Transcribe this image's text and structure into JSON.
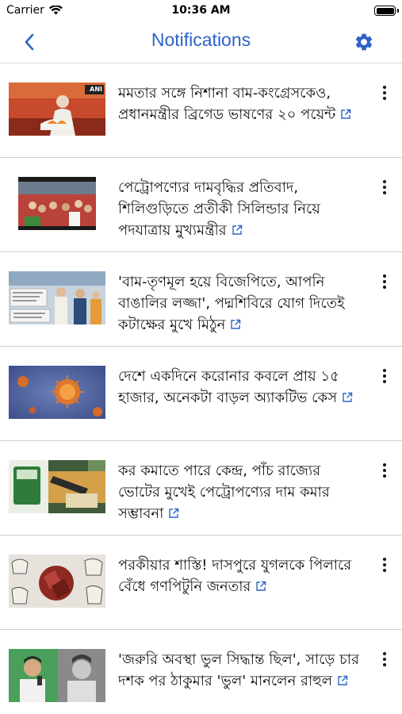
{
  "status_bar": {
    "carrier": "Carrier",
    "time": "10:36 AM"
  },
  "nav": {
    "title": "Notifications",
    "back_icon": "chevron-left-icon",
    "settings_icon": "gear-icon",
    "accent": "#2d63c9"
  },
  "notifications": [
    {
      "headline": "মমতার সঙ্গে নিশানা বাম-কংগ্রেসকেও, প্রধানমন্ত্রীর ব্রিগেড ভাষণের ২০ পয়েন্ট",
      "thumb_badge": "ANI"
    },
    {
      "headline": "পেট্রোপণ্যের দামবৃদ্ধির প্রতিবাদ, শিলিগুড়িতে প্রতীকী সিলিন্ডার নিয়ে পদযাত্রায় মুখ্যমন্ত্রীর"
    },
    {
      "headline": "'বাম-তৃণমূল হয়ে বিজেপিতে, আপনি বাঙালির লজ্জা', পদ্মশিবিরে যোগ দিতেই কটাক্ষের মুখে মিঠুন"
    },
    {
      "headline": "দেশে একদিনে করোনার কবলে প্রায় ১৫ হাজার, অনেকটা বাড়ল অ্যাকটিভ কেস"
    },
    {
      "headline": "কর কমাতে পারে কেন্দ্র, পাঁচ রাজ্যের ভোটের মুখেই পেট্রোপণ্যের দাম কমার সম্ভাবনা"
    },
    {
      "headline": "পরকীয়ার শাস্তি! দাসপুরে যুগলকে পিলারে বেঁধে গণপিটুনি জনতার"
    },
    {
      "headline": "'জরুরি অবস্থা ভুল সিদ্ধান্ত ছিল', সাড়ে চার দশক পর ঠাকুমার 'ভুল' মানলেন রাহুল"
    }
  ]
}
